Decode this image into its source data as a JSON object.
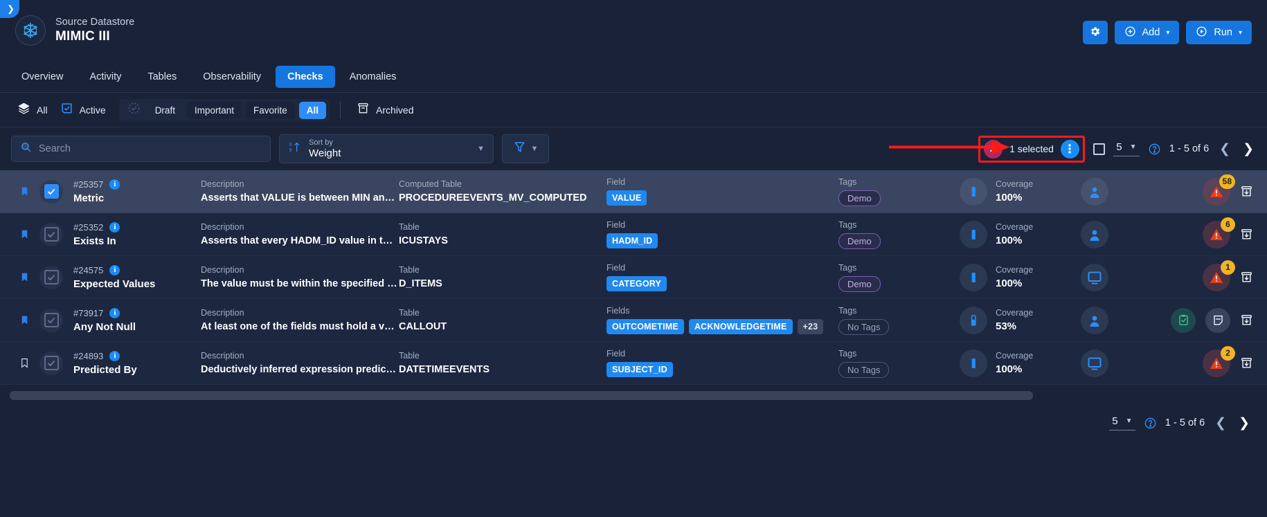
{
  "header": {
    "collapse_icon": "chevron-right-icon",
    "datastore_label": "Source Datastore",
    "datastore_name": "MIMIC III",
    "logo_icon": "snowflake-icon",
    "settings_label": "",
    "settings_icon": "gear-icon",
    "add_label": "Add",
    "add_icon": "plus-circle-icon",
    "run_label": "Run",
    "run_icon": "play-circle-icon",
    "caret": "▾"
  },
  "tabs": [
    {
      "label": "Overview",
      "active": false
    },
    {
      "label": "Activity",
      "active": false
    },
    {
      "label": "Tables",
      "active": false
    },
    {
      "label": "Observability",
      "active": false
    },
    {
      "label": "Checks",
      "active": true
    },
    {
      "label": "Anomalies",
      "active": false
    }
  ],
  "filters": {
    "all_label": "All",
    "all_icon": "layers-icon",
    "active_label": "Active",
    "active_icon": "checkbox-checked-icon",
    "status_icon": "clock-check-icon",
    "segments": [
      {
        "label": "Draft",
        "style": "plain"
      },
      {
        "label": "Important",
        "style": "block"
      },
      {
        "label": "Favorite",
        "style": "block"
      },
      {
        "label": "All",
        "style": "active"
      }
    ],
    "archived_label": "Archived",
    "archived_icon": "archive-icon"
  },
  "toolbar": {
    "search_placeholder": "Search",
    "search_value": "",
    "search_icon": "search-icon",
    "sort_key": "Sort by",
    "sort_value": "Weight",
    "sort_icon": "sort-ascending-icon",
    "filter_icon": "funnel-icon",
    "selected_label": "1 selected",
    "selected_close_icon": "close-x-icon",
    "selected_menu_icon": "kebab-menu-icon",
    "select_all_icon": "checkbox-empty-icon",
    "page_size": "5",
    "help_icon": "help-circle-icon",
    "range_label": "1 - 5 of 6",
    "prev_icon": "chevron-left-icon",
    "next_icon": "chevron-right-icon"
  },
  "footer": {
    "page_size": "5",
    "help_icon": "help-circle-icon",
    "range_label": "1 - 5 of 6",
    "prev_icon": "chevron-left-icon",
    "next_icon": "chevron-right-icon"
  },
  "columns": {
    "description": "Description",
    "computed_table": "Computed Table",
    "table": "Table",
    "field": "Field",
    "fields": "Fields",
    "tags": "Tags",
    "coverage": "Coverage"
  },
  "rows": [
    {
      "selected": true,
      "bookmarked": true,
      "id": "#25357",
      "name": "Metric",
      "desc_key": "Description",
      "desc_value": "Asserts that VALUE is between MIN and MAX",
      "table_key": "Computed Table",
      "table_value": "PROCEDUREEVENTS_MV_COMPUTED",
      "field_key": "Field",
      "fields": [
        "VALUE"
      ],
      "more_fields": "",
      "tags_key": "Tags",
      "tag": "Demo",
      "tag_empty": false,
      "coverage_key": "Coverage",
      "coverage_value": "100%",
      "actor_icon": "user-icon",
      "alert_count": "58",
      "alert_icon": "warning-triangle-icon",
      "extra_icons": [],
      "archive_icon": "archive-box-icon"
    },
    {
      "selected": false,
      "bookmarked": true,
      "id": "#25352",
      "name": "Exists In",
      "desc_key": "Description",
      "desc_value": "Asserts that every HADM_ID value in the ICUS…",
      "table_key": "Table",
      "table_value": "ICUSTAYS",
      "field_key": "Field",
      "fields": [
        "HADM_ID"
      ],
      "more_fields": "",
      "tags_key": "Tags",
      "tag": "Demo",
      "tag_empty": false,
      "coverage_key": "Coverage",
      "coverage_value": "100%",
      "actor_icon": "user-icon",
      "alert_count": "6",
      "alert_icon": "warning-triangle-icon",
      "extra_icons": [],
      "archive_icon": "archive-box-icon"
    },
    {
      "selected": false,
      "bookmarked": true,
      "id": "#24575",
      "name": "Expected Values",
      "desc_key": "Description",
      "desc_value": "The value must be within the specified list of v…",
      "table_key": "Table",
      "table_value": "D_ITEMS",
      "field_key": "Field",
      "fields": [
        "CATEGORY"
      ],
      "more_fields": "",
      "tags_key": "Tags",
      "tag": "Demo",
      "tag_empty": false,
      "coverage_key": "Coverage",
      "coverage_value": "100%",
      "actor_icon": "monitor-icon",
      "alert_count": "1",
      "alert_icon": "warning-triangle-icon",
      "extra_icons": [],
      "archive_icon": "archive-box-icon"
    },
    {
      "selected": false,
      "bookmarked": true,
      "id": "#73917",
      "name": "Any Not Null",
      "desc_key": "Description",
      "desc_value": "At least one of the fields must hold a value",
      "table_key": "Table",
      "table_value": "CALLOUT",
      "field_key": "Fields",
      "fields": [
        "OUTCOMETIME",
        "ACKNOWLEDGETIME"
      ],
      "more_fields": "+23",
      "tags_key": "Tags",
      "tag": "No Tags",
      "tag_empty": true,
      "coverage_key": "Coverage",
      "coverage_value": "53%",
      "actor_icon": "user-icon",
      "alert_count": "",
      "alert_icon": "",
      "extra_icons": [
        "clipboard-check-icon",
        "note-minus-icon"
      ],
      "archive_icon": "archive-box-icon"
    },
    {
      "selected": false,
      "bookmarked": false,
      "id": "#24893",
      "name": "Predicted By",
      "desc_key": "Description",
      "desc_value": "Deductively inferred expression predicts a val…",
      "table_key": "Table",
      "table_value": "DATETIMEEVENTS",
      "field_key": "Field",
      "fields": [
        "SUBJECT_ID"
      ],
      "more_fields": "",
      "tags_key": "Tags",
      "tag": "No Tags",
      "tag_empty": true,
      "coverage_key": "Coverage",
      "coverage_value": "100%",
      "actor_icon": "monitor-icon",
      "alert_count": "2",
      "alert_icon": "warning-triangle-icon",
      "extra_icons": [],
      "archive_icon": "archive-box-icon"
    }
  ],
  "colors": {
    "accent": "#1576e0",
    "bg": "#1a2238",
    "row_bg": "#1d2740",
    "row_selected": "#3a4661",
    "chip": "#2089f0",
    "annotation": "#ff1a1a",
    "selected_chip": "#b3295f",
    "badge": "#f0b429"
  }
}
